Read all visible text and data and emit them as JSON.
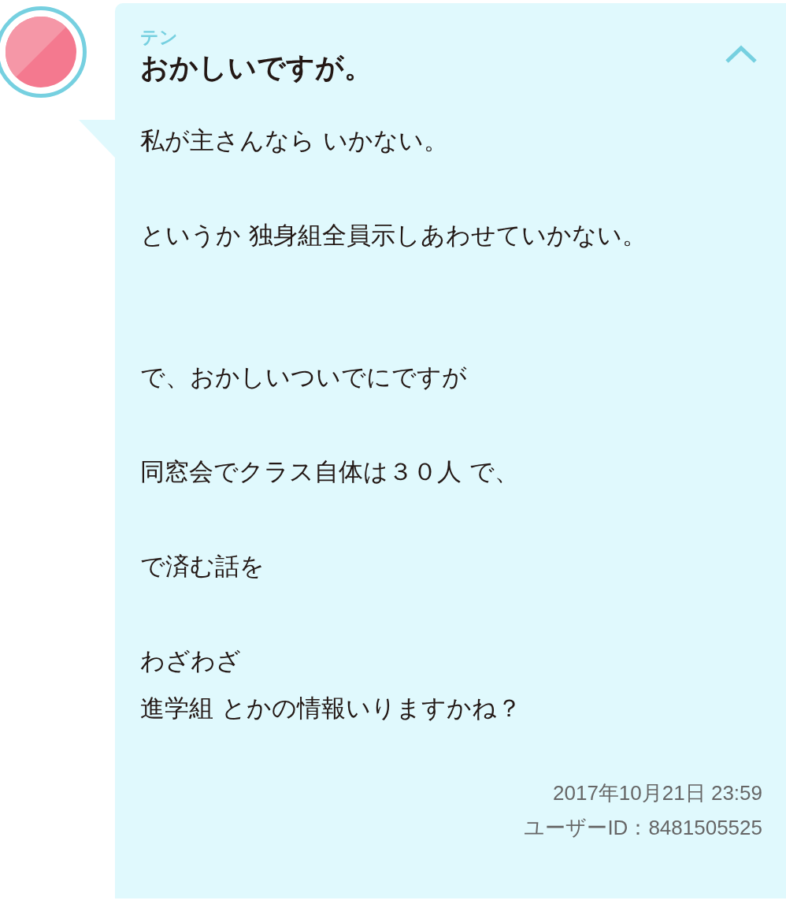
{
  "post": {
    "author": "テン",
    "title": "おかしいですが。",
    "expanded": true,
    "paragraphs": [
      {
        "kind": "paragraph",
        "lines": [
          "私が主さんなら いかない。"
        ]
      },
      {
        "kind": "paragraph",
        "lines": [
          "というか 独身組全員示しあわせていかない。"
        ]
      },
      {
        "kind": "section",
        "lines": [
          "で、おかしいついでにですが"
        ]
      },
      {
        "kind": "paragraph",
        "lines": [
          "同窓会でクラス自体は３０人 で、"
        ]
      },
      {
        "kind": "paragraph",
        "lines": [
          "で済む話を"
        ]
      },
      {
        "kind": "paragraph",
        "lines": [
          "わざわざ",
          "進学組 とかの情報いりますかね？"
        ]
      }
    ],
    "date": "2017年10月21日 23:59",
    "user_id": "ユーザーID：8481505525"
  }
}
